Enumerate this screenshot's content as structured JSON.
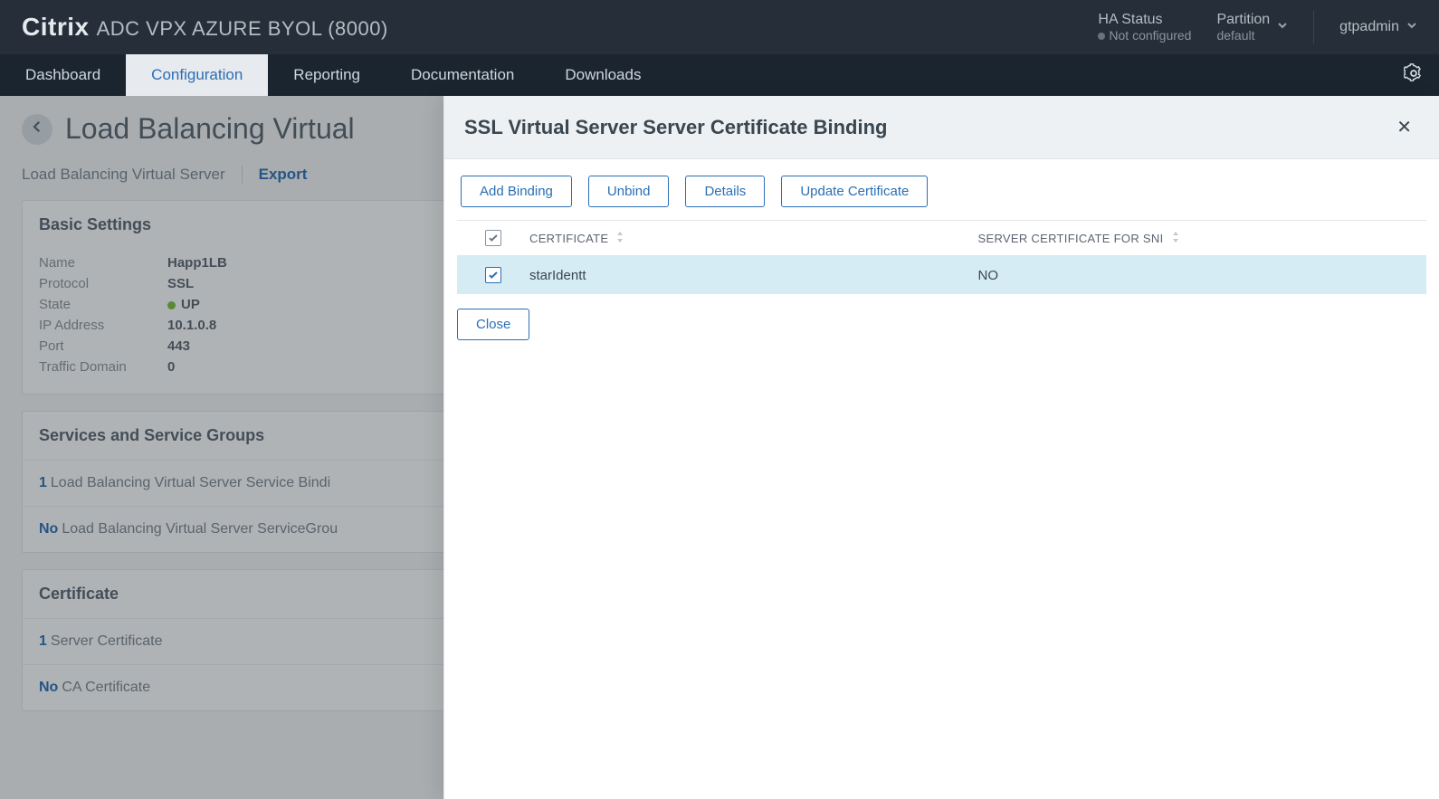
{
  "brand": {
    "name": "Citrix",
    "product": "ADC VPX AZURE BYOL (8000)"
  },
  "header": {
    "ha_label": "HA Status",
    "ha_value": "Not configured",
    "partition_label": "Partition",
    "partition_value": "default",
    "user": "gtpadmin"
  },
  "nav": {
    "dashboard": "Dashboard",
    "configuration": "Configuration",
    "reporting": "Reporting",
    "documentation": "Documentation",
    "downloads": "Downloads"
  },
  "page": {
    "title": "Load Balancing Virtual",
    "crumb1": "Load Balancing Virtual Server",
    "export": "Export",
    "basic_settings": "Basic Settings",
    "kv": {
      "name_k": "Name",
      "name_v": "Happ1LB",
      "protocol_k": "Protocol",
      "protocol_v": "SSL",
      "state_k": "State",
      "state_v": "UP",
      "ip_k": "IP Address",
      "ip_v": "10.1.0.8",
      "port_k": "Port",
      "port_v": "443",
      "td_k": "Traffic Domain",
      "td_v": "0"
    },
    "services_header": "Services and Service Groups",
    "svc1_num": "1",
    "svc1_text": "Load Balancing Virtual Server Service Bindi",
    "svc2_no": "No",
    "svc2_text": "Load Balancing Virtual Server ServiceGrou",
    "cert_header": "Certificate",
    "cert1_num": "1",
    "cert1_text": "Server Certificate",
    "cert2_no": "No",
    "cert2_text": "CA Certificate"
  },
  "sheet": {
    "title": "SSL Virtual Server Server Certificate Binding",
    "buttons": {
      "add": "Add Binding",
      "unbind": "Unbind",
      "details": "Details",
      "update": "Update Certificate",
      "close": "Close"
    },
    "columns": {
      "cert": "CERTIFICATE",
      "sni": "SERVER CERTIFICATE FOR SNI"
    },
    "rows": [
      {
        "certificate": "starIdentt",
        "sni": "NO"
      }
    ]
  }
}
